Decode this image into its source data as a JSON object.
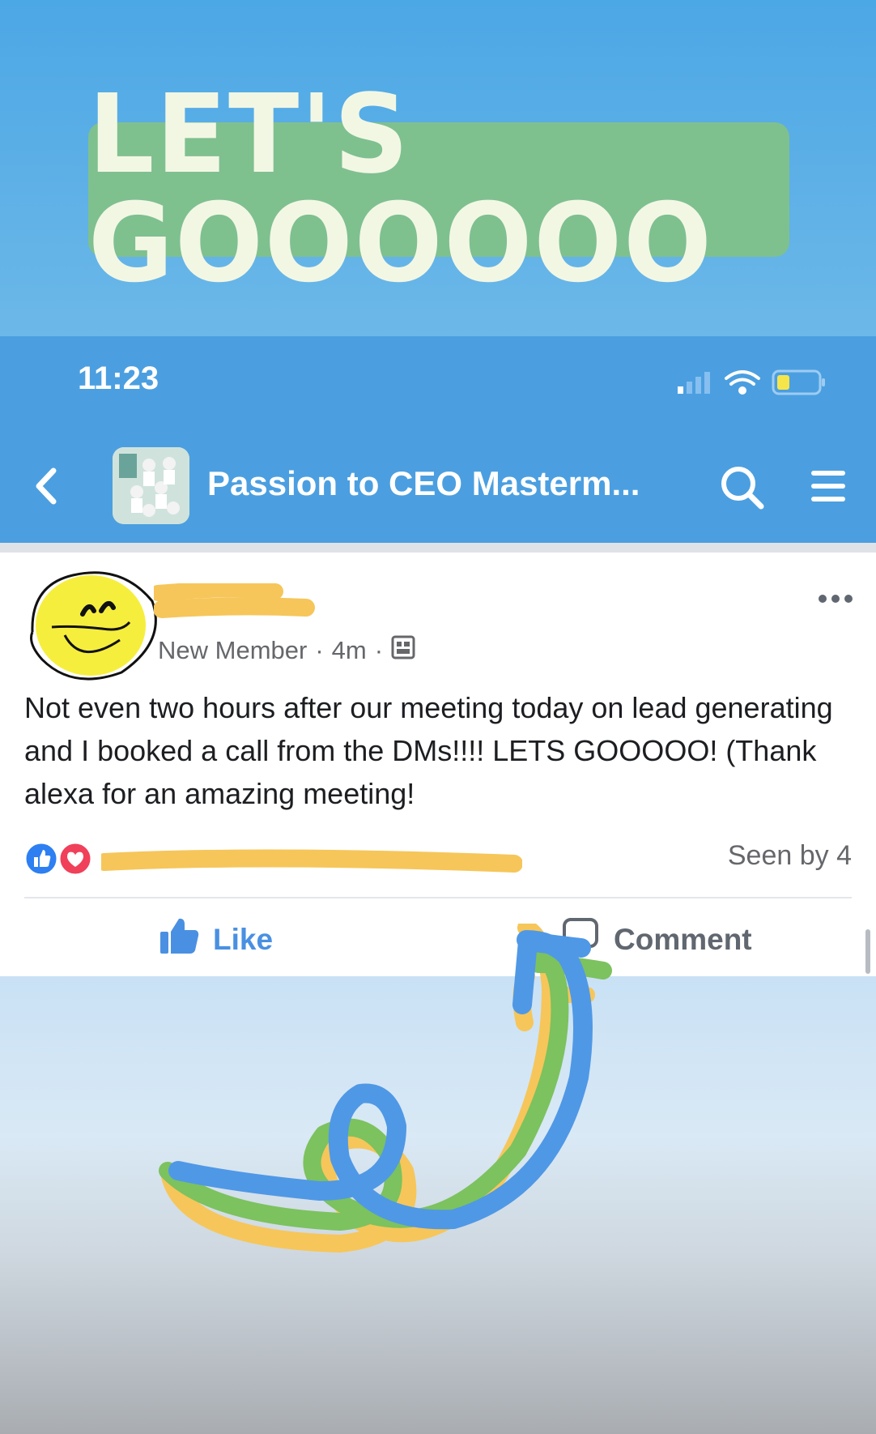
{
  "story": {
    "sticker_text": "LET'S GOOOOOO"
  },
  "status_bar": {
    "time": "11:23"
  },
  "nav": {
    "group_title": "Passion to CEO Masterm..."
  },
  "post": {
    "role": "New Member",
    "age": "4m",
    "separator": "·",
    "body": "Not even two hours after our meeting today on lead generating and I booked a call from the DMs!!!! LETS GOOOOO! (Thank alexa for an amazing meeting!",
    "seen_by": "Seen by 4",
    "like_label": "Like",
    "comment_label": "Comment"
  },
  "colors": {
    "sticker_bg": "#7fc08f",
    "app_blue": "#4b9fe0",
    "like_blue": "#4a90e2",
    "love_red": "#f0405a"
  }
}
